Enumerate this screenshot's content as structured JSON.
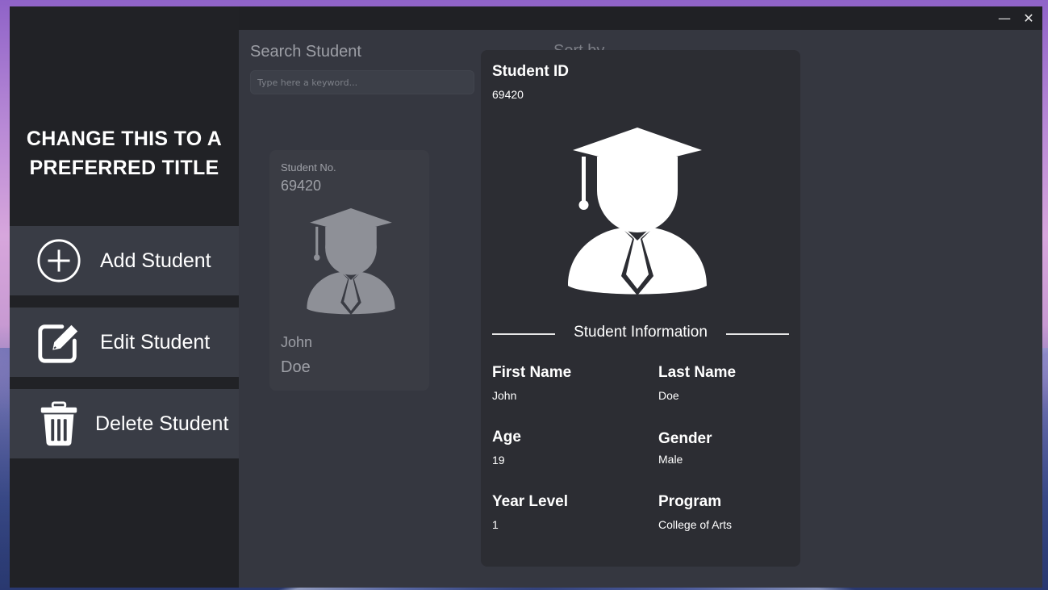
{
  "window": {
    "minimize_glyph": "—",
    "close_glyph": "✕"
  },
  "sidebar": {
    "title": "CHANGE THIS TO A\nPREFERRED TITLE",
    "items": [
      {
        "label": "Add Student",
        "icon": "add-circle-icon"
      },
      {
        "label": "Edit Student",
        "icon": "edit-icon"
      },
      {
        "label": "Delete Student",
        "icon": "trash-icon"
      }
    ]
  },
  "search": {
    "label": "Search Student",
    "placeholder": "Type here a keyword..."
  },
  "behind_text": "Sort by",
  "card": {
    "no_label": "Student No.",
    "no_value": "69420",
    "first_name": "John",
    "last_name": "Doe",
    "avatar_icon": "graduate-icon"
  },
  "detail": {
    "id_label": "Student ID",
    "id_value": "69420",
    "avatar_icon": "graduate-icon",
    "section_title": "Student Information",
    "fields": [
      {
        "label": "First Name",
        "value": "John"
      },
      {
        "label": "Last Name",
        "value": "Doe"
      },
      {
        "label": "Age",
        "value": "19"
      },
      {
        "label": "Gender",
        "value": "Male"
      },
      {
        "label": "Year Level",
        "value": "1"
      },
      {
        "label": "Program",
        "value": "College of Arts"
      }
    ]
  },
  "colors": {
    "sidebar_bg": "#212226",
    "nav_button_bg": "#393c45",
    "main_bg": "#353740",
    "card_bg": "#3a3c44",
    "detail_bg": "#2c2d33",
    "muted_text": "#9ea0a7",
    "text": "#ffffff"
  }
}
